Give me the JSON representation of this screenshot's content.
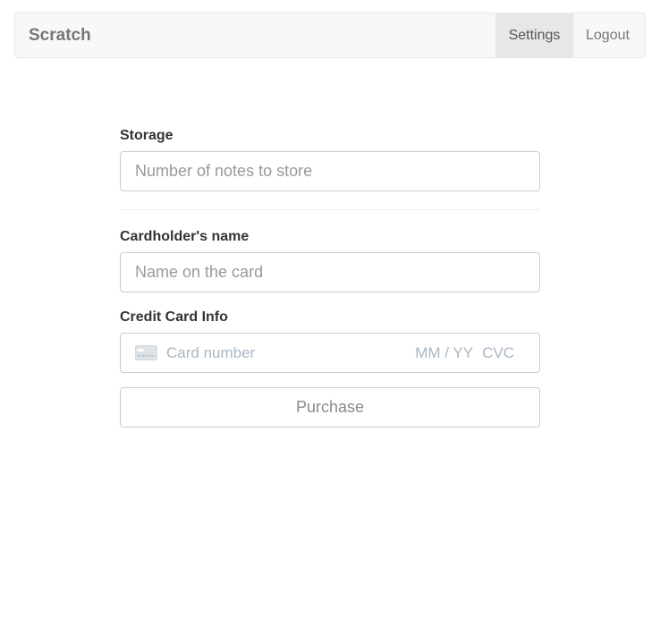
{
  "navbar": {
    "brand": "Scratch",
    "links": [
      {
        "label": "Settings",
        "active": true
      },
      {
        "label": "Logout",
        "active": false
      }
    ]
  },
  "form": {
    "storage": {
      "label": "Storage",
      "placeholder": "Number of notes to store",
      "value": ""
    },
    "cardholder": {
      "label": "Cardholder's name",
      "placeholder": "Name on the card",
      "value": ""
    },
    "card_info": {
      "label": "Credit Card Info",
      "icon": "credit-card-icon",
      "number_placeholder": "Card number",
      "expiry_placeholder": "MM / YY",
      "cvc_placeholder": "CVC"
    },
    "submit_label": "Purchase"
  },
  "colors": {
    "navbar_bg": "#f8f8f8",
    "active_link_bg": "#e7e7e7",
    "card_placeholder": "#aab7c4"
  }
}
